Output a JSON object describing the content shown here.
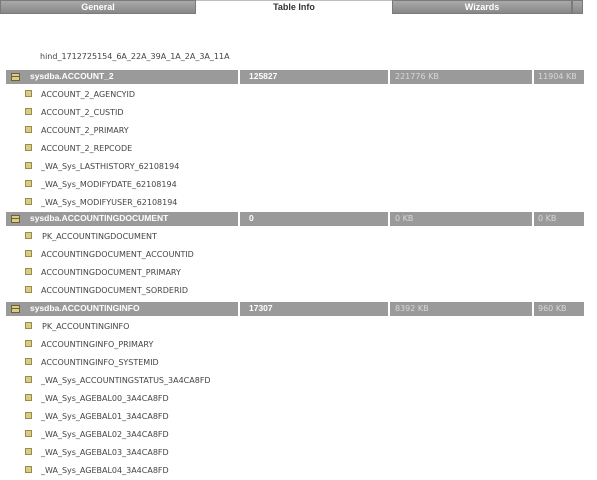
{
  "tabs": {
    "general": "General",
    "table_info": "Table Info",
    "wizards": "Wizards"
  },
  "top_item": "hind_1712725154_6A_22A_39A_1A_2A_3A_11A",
  "tables": [
    {
      "name": "sysdba.ACCOUNT_2",
      "rows": "125827",
      "data_size": "221776 KB",
      "index_size": "11904 KB",
      "indexes": [
        "ACCOUNT_2_AGENCYID",
        "ACCOUNT_2_CUSTID",
        "ACCOUNT_2_PRIMARY",
        "ACCOUNT_2_REPCODE",
        "_WA_Sys_LASTHISTORY_62108194",
        "_WA_Sys_MODIFYDATE_62108194",
        "_WA_Sys_MODIFYUSER_62108194"
      ]
    },
    {
      "name": "sysdba.ACCOUNTINGDOCUMENT",
      "rows": "0",
      "data_size": "0 KB",
      "index_size": "0 KB",
      "indexes": [
        "PK_ACCOUNTINGDOCUMENT",
        "ACCOUNTINGDOCUMENT_ACCOUNTID",
        "ACCOUNTINGDOCUMENT_PRIMARY",
        "ACCOUNTINGDOCUMENT_SORDERID"
      ]
    },
    {
      "name": "sysdba.ACCOUNTINGINFO",
      "rows": "17307",
      "data_size": "8392 KB",
      "index_size": "960 KB",
      "indexes": [
        "PK_ACCOUNTINGINFO",
        "ACCOUNTINGINFO_PRIMARY",
        "ACCOUNTINGINFO_SYSTEMID",
        "_WA_Sys_ACCOUNTINGSTATUS_3A4CA8FD",
        "_WA_Sys_AGEBAL00_3A4CA8FD",
        "_WA_Sys_AGEBAL01_3A4CA8FD",
        "_WA_Sys_AGEBAL02_3A4CA8FD",
        "_WA_Sys_AGEBAL03_3A4CA8FD",
        "_WA_Sys_AGEBAL04_3A4CA8FD"
      ]
    }
  ]
}
